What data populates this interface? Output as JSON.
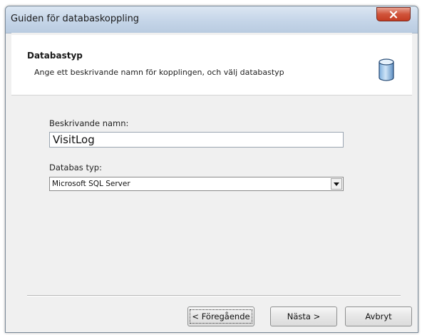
{
  "window": {
    "title": "Guiden för databaskoppling",
    "close_icon": "close-icon"
  },
  "header": {
    "title": "Databastyp",
    "subtitle": "Ange ett beskrivande namn för kopplingen, och välj databastyp",
    "icon": "database-icon"
  },
  "form": {
    "name_label": "Beskrivande namn:",
    "name_value": "VisitLog",
    "type_label": "Databas typ:",
    "type_selected": "Microsoft SQL Server"
  },
  "buttons": {
    "previous": "< Föregående",
    "next": "Nästa >",
    "cancel": "Avbryt"
  }
}
